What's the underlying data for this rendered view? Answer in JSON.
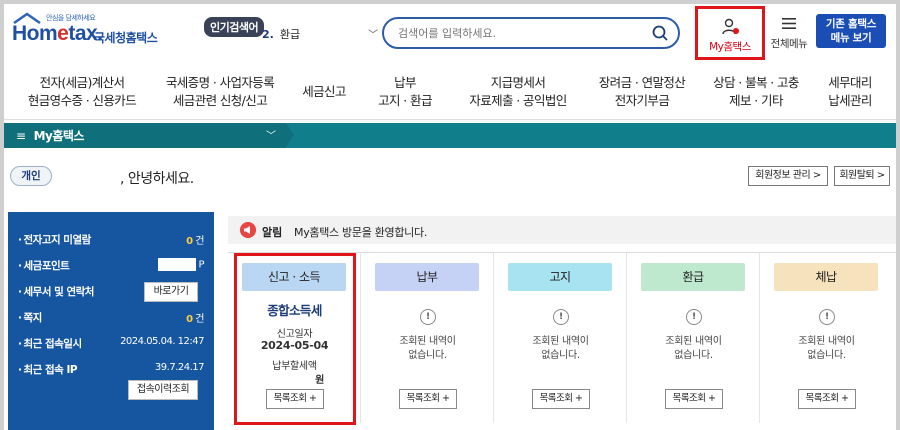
{
  "header": {
    "logo_tag": "안심을 담세하세요",
    "logo_brand_1": "Hom",
    "logo_brand_2": "e",
    "logo_brand_3": "tax.",
    "logo_kr": "국세청홈택스",
    "popular_label": "인기검색어",
    "popular_num": "2.",
    "popular_text": "환급",
    "search_placeholder": "검색어를 입력하세요.",
    "myhometax": "My홈택스",
    "allmenu": "전체메뉴",
    "old_btn_line1": "기존 홈택스",
    "old_btn_line2": "메뉴 보기"
  },
  "nav": [
    {
      "l1": "전자(세금)계산서",
      "l2": "현금영수증 · 신용카드"
    },
    {
      "l1": "국세증명 · 사업자등록",
      "l2": "세금관련 신청/신고"
    },
    {
      "l1": "세금신고",
      "l2": ""
    },
    {
      "l1": "납부",
      "l2": "고지 · 환급"
    },
    {
      "l1": "지급명세서",
      "l2": "자료제출 · 공익법인"
    },
    {
      "l1": "장려금 · 연말정산",
      "l2": "전자기부금"
    },
    {
      "l1": "상담 · 불복 · 고충",
      "l2": "제보 · 기타"
    },
    {
      "l1": "세무대리",
      "l2": "납세관리"
    }
  ],
  "teal": {
    "menu_label": "My홈택스"
  },
  "greeting": {
    "pill": "개인",
    "hello": ", 안녕하세요.",
    "member_btn": "회원정보 관리 >",
    "withdraw_btn": "회원탈퇴 >"
  },
  "left": {
    "rows": [
      {
        "label": "전자고지 미열람",
        "value_num": "0",
        "value_unit": "건"
      },
      {
        "label": "세금포인트",
        "value_unit": "P"
      },
      {
        "label": "세무서 및 연락처"
      },
      {
        "label": "쪽지",
        "value_num": "0",
        "value_unit": "건"
      },
      {
        "label": "최근 접속일시",
        "value": "2024.05.04.  12:47"
      },
      {
        "label": "최근 접속 IP",
        "value": "39.7.24.17"
      }
    ],
    "go_btn": "바로가기",
    "history_btn": "접속이력조회"
  },
  "notice": {
    "label": "알림",
    "msg": "My홈택스 방문을 환영합니다."
  },
  "cards": [
    {
      "head": "신고 · 소득",
      "color": "#b9d6f2",
      "title": "종합소득세",
      "sub1": "신고일자",
      "date": "2024-05-04",
      "sub2": "납부할세액",
      "amount_unit": "원",
      "btn": "목록조회 +"
    },
    {
      "head": "납부",
      "color": "#c6d2f5",
      "empty1": "조회된 내역이",
      "empty2": "없습니다.",
      "btn": "목록조회 +"
    },
    {
      "head": "고지",
      "color": "#a8e3f1",
      "empty1": "조회된 내역이",
      "empty2": "없습니다.",
      "btn": "목록조회 +"
    },
    {
      "head": "환급",
      "color": "#bfe9cf",
      "empty1": "조회된 내역이",
      "empty2": "없습니다.",
      "btn": "목록조회 +"
    },
    {
      "head": "체납",
      "color": "#f6e3bd",
      "empty1": "조회된 내역이",
      "empty2": "없습니다.",
      "btn": "목록조회 +"
    }
  ],
  "colors": {
    "brand": "#1e4fa5",
    "teal": "#117f8b",
    "panel": "#16559f",
    "highlight": "#e0151a"
  }
}
